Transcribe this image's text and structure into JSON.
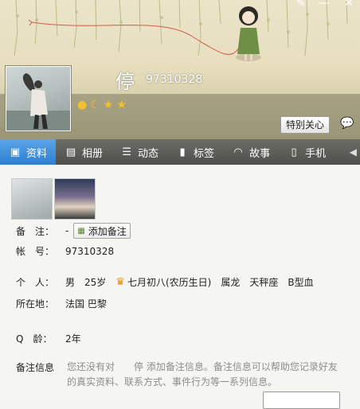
{
  "profile": {
    "nickname": "停",
    "qq_number": "97310328",
    "special_care_label": "特别关心"
  },
  "badges": [
    "sun-level-icon",
    "moon-level-icon",
    "star-level-icon",
    "star-level-icon"
  ],
  "tabs": [
    {
      "label": "资料",
      "icon": "profile-card-icon",
      "active": true
    },
    {
      "label": "相册",
      "icon": "photo-album-icon",
      "active": false
    },
    {
      "label": "动态",
      "icon": "feed-list-icon",
      "active": false
    },
    {
      "label": "标签",
      "icon": "tag-icon",
      "active": false
    },
    {
      "label": "故事",
      "icon": "story-icon",
      "active": false
    },
    {
      "label": "手机",
      "icon": "phone-icon",
      "active": false
    }
  ],
  "info": {
    "remark_label": "备　注：",
    "remark_value": "-",
    "add_remark_label": "添加备注",
    "account_label": "帐　号：",
    "account_value": "97310328",
    "personal_label": "个　人：",
    "gender": "男",
    "age": "25岁",
    "birthday": "七月初八(农历生日)",
    "zodiac": "属龙",
    "constellation": "天秤座",
    "blood_type": "B型血",
    "location_label": "所在地：",
    "location_value": "法国 巴黎",
    "qage_label": "Q　龄：",
    "qage_value": "2年",
    "remark_info_label": "备注信息",
    "remark_info_text": "您还没有对　　停 添加备注信息。备注信息可以帮助您记录好友的真实资料、联系方式、事件行为等一系列信息。"
  },
  "colors": {
    "tab_active": "#2f7fd0",
    "tab_bar": "#5c5c58",
    "header_band": "#9c9678"
  }
}
